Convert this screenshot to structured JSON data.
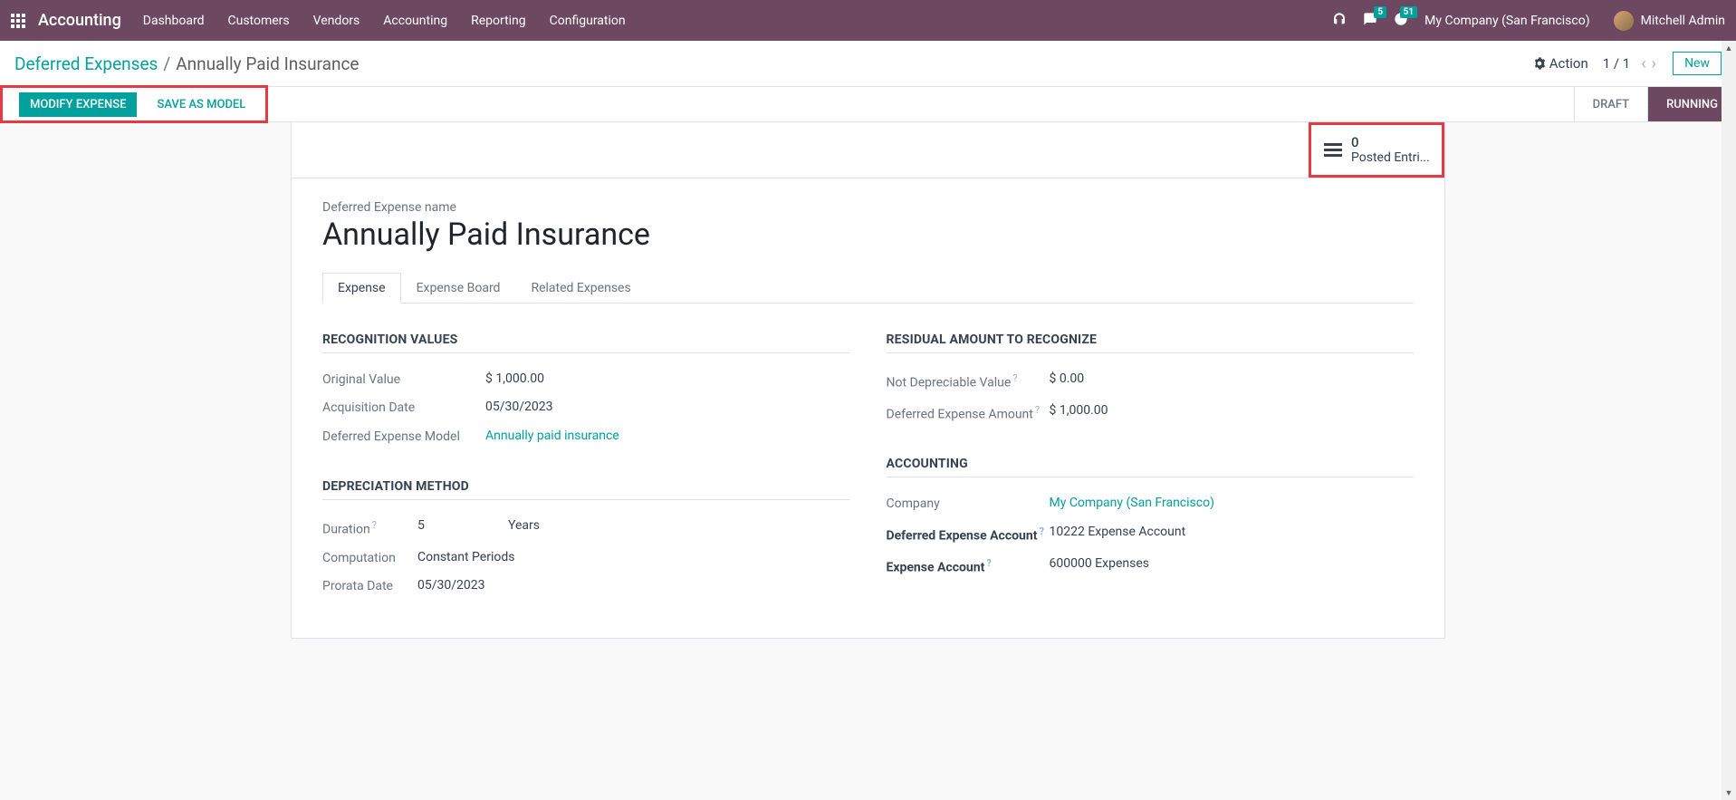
{
  "topnav": {
    "app_name": "Accounting",
    "menu": [
      "Dashboard",
      "Customers",
      "Vendors",
      "Accounting",
      "Reporting",
      "Configuration"
    ],
    "messages_badge": "5",
    "activities_badge": "51",
    "company": "My Company (San Francisco)",
    "user": "Mitchell Admin"
  },
  "breadcrumb": {
    "parent": "Deferred Expenses",
    "current": "Annually Paid Insurance",
    "action_label": "Action",
    "pager": "1 / 1",
    "new_label": "New"
  },
  "actionbar": {
    "modify": "MODIFY EXPENSE",
    "save_model": "SAVE AS MODEL",
    "status_draft": "DRAFT",
    "status_running": "RUNNING"
  },
  "stat": {
    "value": "0",
    "label": "Posted Entri..."
  },
  "title": {
    "label": "Deferred Expense name",
    "value": "Annually Paid Insurance"
  },
  "tabs": [
    "Expense",
    "Expense Board",
    "Related Expenses"
  ],
  "sections": {
    "recognition": {
      "header": "RECOGNITION VALUES",
      "original_value_label": "Original Value",
      "original_value": "$ 1,000.00",
      "acquisition_date_label": "Acquisition Date",
      "acquisition_date": "05/30/2023",
      "model_label": "Deferred Expense Model",
      "model_value": "Annually paid insurance"
    },
    "residual": {
      "header": "RESIDUAL AMOUNT TO RECOGNIZE",
      "not_depreciable_label": "Not Depreciable Value",
      "not_depreciable_value": "$ 0.00",
      "deferred_amount_label": "Deferred Expense Amount",
      "deferred_amount_value": "$ 1,000.00"
    },
    "depreciation": {
      "header": "DEPRECIATION METHOD",
      "duration_label": "Duration",
      "duration_value": "5",
      "duration_unit": "Years",
      "computation_label": "Computation",
      "computation_value": "Constant Periods",
      "prorata_label": "Prorata Date",
      "prorata_value": "05/30/2023"
    },
    "accounting": {
      "header": "ACCOUNTING",
      "company_label": "Company",
      "company_value": "My Company (San Francisco)",
      "def_account_label": "Deferred Expense Account",
      "def_account_value": "10222 Expense Account",
      "exp_account_label": "Expense Account",
      "exp_account_value": "600000 Expenses"
    }
  }
}
